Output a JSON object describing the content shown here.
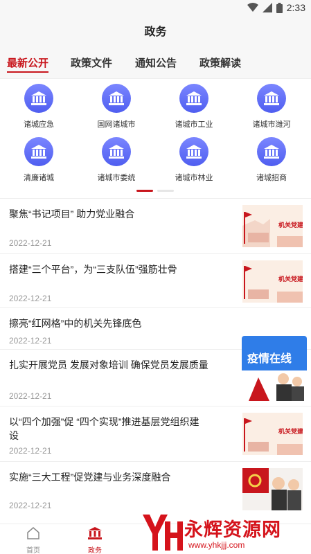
{
  "status_bar": {
    "time": "2:33"
  },
  "header": {
    "title": "政务"
  },
  "tabs": [
    {
      "label": "最新公开",
      "active": true
    },
    {
      "label": "政策文件",
      "active": false
    },
    {
      "label": "通知公告",
      "active": false
    },
    {
      "label": "政策解读",
      "active": false
    }
  ],
  "categories": [
    {
      "label": "诸城应急"
    },
    {
      "label": "国网诸城市"
    },
    {
      "label": "诸城市工业"
    },
    {
      "label": "诸城市潍河"
    },
    {
      "label": "清廉诸城"
    },
    {
      "label": "诸城市委统"
    },
    {
      "label": "诸城市林业"
    },
    {
      "label": "诸城招商"
    }
  ],
  "news": [
    {
      "title": "聚焦“书记项目” 助力党业融合",
      "date": "2022-12-21",
      "thumb": "机关党建"
    },
    {
      "title": "搭建“三个平台”，为“三支队伍”强筋壮骨",
      "date": "2022-12-21",
      "thumb": "机关党建"
    },
    {
      "title": "擦亮“红网格”中的机关先锋底色",
      "date": "2022-12-21",
      "thumb": ""
    },
    {
      "title": "扎实开展党员 发展对象培训 确保党员发展质量",
      "date": "2022-12-21",
      "thumb": "疫情在线"
    },
    {
      "title_line1": "以“四个加强”促 “四个实现”推进基层党组织建",
      "title_line2": "设",
      "date": "2022-12-21",
      "thumb": "机关党建"
    },
    {
      "title": "实施“三大工程”促党建与业务深度融合",
      "date": "2022-12-21",
      "thumb": ""
    }
  ],
  "bottom_nav": [
    {
      "label": "首页",
      "icon": "home-icon",
      "active": false
    },
    {
      "label": "政务",
      "icon": "government-icon",
      "active": true
    },
    {
      "label": "",
      "icon": "",
      "active": false
    },
    {
      "label": "",
      "icon": "",
      "active": false
    }
  ],
  "watermark": {
    "text": "永辉资源网",
    "url": "www.yhkjjj.com",
    "logo": "YH"
  },
  "colors": {
    "accent": "#c8161d",
    "icon_blue": "#5a67f2",
    "date_gray": "#999999"
  }
}
